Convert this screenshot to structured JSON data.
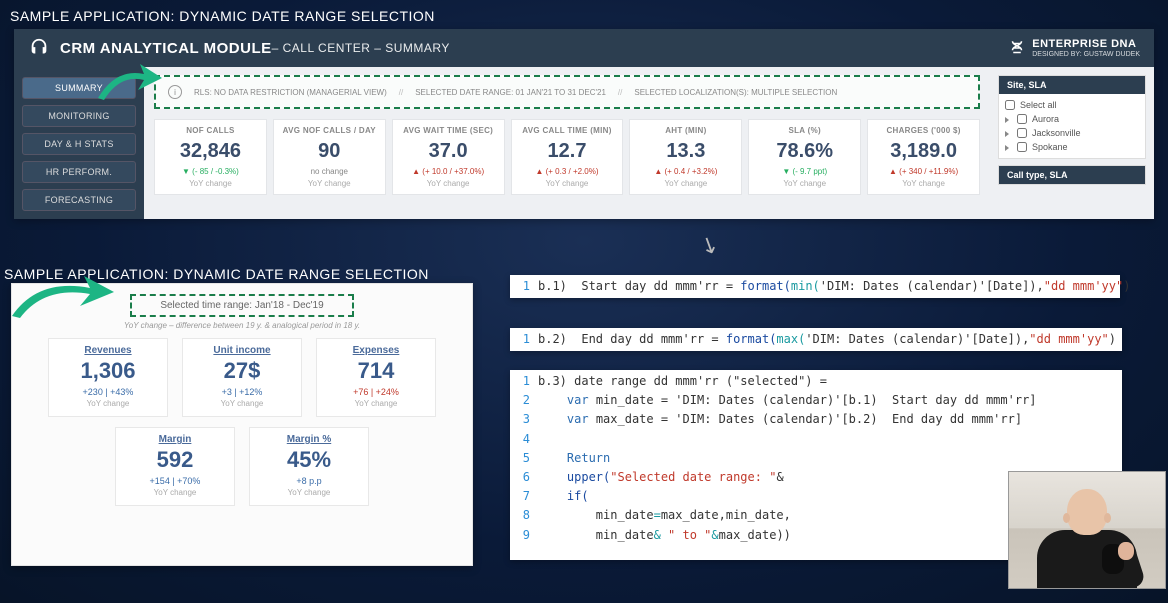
{
  "titles": {
    "top": "SAMPLE APPLICATION: DYNAMIC DATE RANGE SELECTION",
    "mid": "SAMPLE APPLICATION: DYNAMIC DATE RANGE SELECTION"
  },
  "crm": {
    "title": "CRM ANALYTICAL MODULE",
    "sub": " – CALL CENTER – SUMMARY",
    "brand": "ENTERPRISE DNA",
    "brand_sub": "DESIGNED BY: GUSTAW DUDEK",
    "nav": [
      "SUMMARY",
      "MONITORING",
      "DAY & H STATS",
      "HR PERFORM.",
      "FORECASTING"
    ],
    "info": {
      "rls": "RLS: NO DATA RESTRICTION (MANAGERIAL VIEW)",
      "range": "SELECTED DATE RANGE: 01 JAN'21 TO 31 DEC'21",
      "loc": "SELECTED LOCALIZATION(S): MULTIPLE SELECTION",
      "sep": "//"
    },
    "kpis": [
      {
        "lbl": "NOF CALLS",
        "val": "32,846",
        "chg": "▼ (- 85 / -0.3%)",
        "cls": "dn",
        "yoy": "YoY change"
      },
      {
        "lbl": "AVG NOF CALLS / DAY",
        "val": "90",
        "chg": "no change",
        "cls": "no",
        "yoy": "YoY change"
      },
      {
        "lbl": "AVG WAIT TIME (SEC)",
        "val": "37.0",
        "chg": "▲ (+ 10.0 / +37.0%)",
        "cls": "up",
        "yoy": "YoY change"
      },
      {
        "lbl": "AVG CALL TIME (MIN)",
        "val": "12.7",
        "chg": "▲ (+ 0.3 / +2.0%)",
        "cls": "up",
        "yoy": "YoY change"
      },
      {
        "lbl": "AHT (MIN)",
        "val": "13.3",
        "chg": "▲ (+ 0.4 / +3.2%)",
        "cls": "up",
        "yoy": "YoY change"
      },
      {
        "lbl": "SLA (%)",
        "val": "78.6%",
        "chg": "▼ (- 9.7 ppt)",
        "cls": "dn",
        "yoy": "YoY change"
      },
      {
        "lbl": "CHARGES ('000 $)",
        "val": "3,189.0",
        "chg": "▲ (+ 340 / +11.9%)",
        "cls": "up",
        "yoy": "YoY change"
      }
    ],
    "slicer1": {
      "hdr": "Site, SLA",
      "all": "Select all",
      "items": [
        "Aurora",
        "Jacksonville",
        "Spokane"
      ]
    },
    "slicer2": {
      "hdr": "Call type, SLA"
    }
  },
  "p2": {
    "sel_lbl": "Selected time range:",
    "sel_val": "Jan'18 - Dec'19",
    "sub": "YoY change – difference between 19 y. & analogical period in 18 y.",
    "cards1": [
      {
        "nm": "Revenues",
        "val": "1,306",
        "dl": "+230 | +43%",
        "cls": "b"
      },
      {
        "nm": "Unit income",
        "val": "27$",
        "dl": "+3 | +12%",
        "cls": "b"
      },
      {
        "nm": "Expenses",
        "val": "714",
        "dl": "+76 | +24%",
        "cls": "r"
      }
    ],
    "cards2": [
      {
        "nm": "Margin",
        "val": "592",
        "dl": "+154 | +70%",
        "cls": "b"
      },
      {
        "nm": "Margin %",
        "val": "45%",
        "dl": "+8 p.p",
        "cls": "b"
      }
    ],
    "yoy": "YoY change"
  },
  "code1": {
    "ln": "1",
    "pre": "b.1)  Start day dd mmm'rr = ",
    "fn": "format(",
    "mid": "min(",
    "arg": "'DIM: Dates (calendar)'[Date]),",
    "str": "\"dd mmm'yy\"",
    "end": ")"
  },
  "code2": {
    "ln": "1",
    "pre": "b.2)  End day dd mmm'rr = ",
    "fn": "format(",
    "mid": "max(",
    "arg": "'DIM: Dates (calendar)'[Date]),",
    "str": "\"dd mmm'yy\"",
    "end": ")"
  },
  "code3": {
    "l1": "b.3) date range dd mmm'rr (\"selected\") =",
    "l2_a": "var",
    "l2_b": " min_date = 'DIM: Dates (calendar)'[b.1)  Start day dd mmm'rr]",
    "l3_a": "var",
    "l3_b": " max_date = 'DIM: Dates (calendar)'[b.2)  End day dd mmm'rr]",
    "l5": "Return",
    "l6_a": "upper(",
    "l6_b": "\"Selected date range: \"",
    "l6_c": "&",
    "l7_a": "if(",
    "l8_a": "min_date",
    "l8_b": "=",
    "l8_c": "max_date,min_date,",
    "l9_a": "min_date",
    "l9_b": "&",
    "l9_c": " \" to \"",
    "l9_d": "&",
    "l9_e": "max_date",
    "l9_f": "))"
  }
}
